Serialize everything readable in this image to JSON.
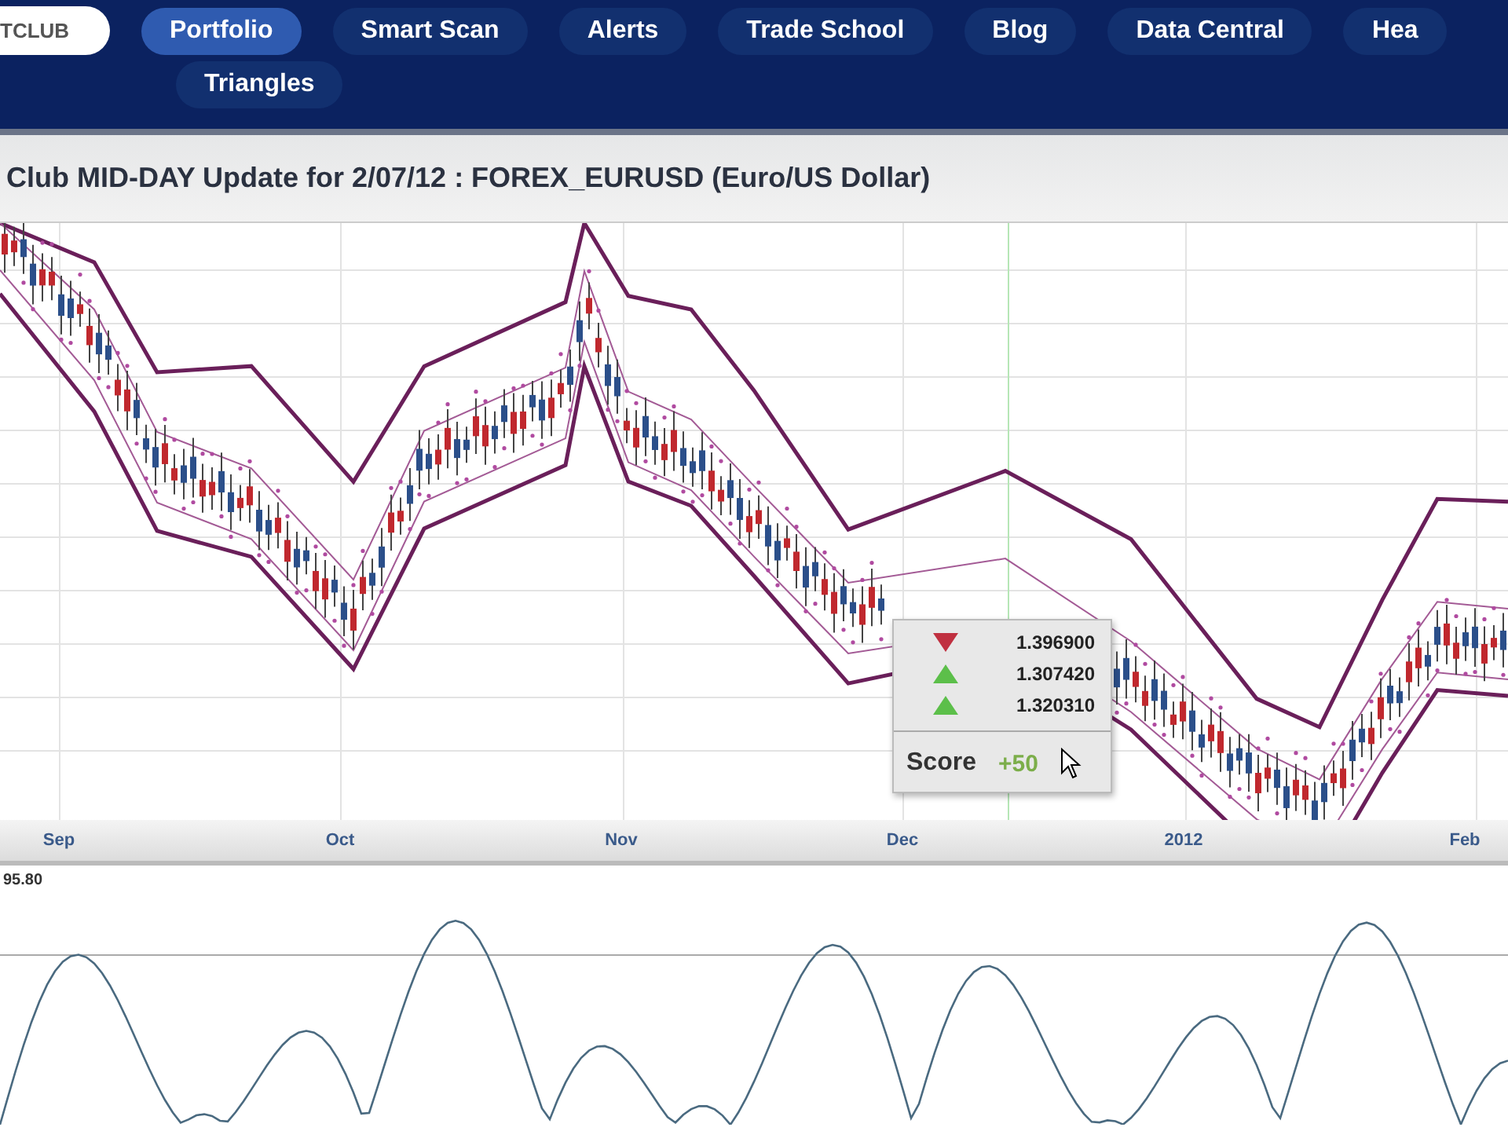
{
  "logo": {
    "text": "TCLUB"
  },
  "nav": {
    "items": [
      {
        "label": "Portfolio",
        "selected": true
      },
      {
        "label": "Smart Scan",
        "selected": false
      },
      {
        "label": "Alerts",
        "selected": false
      },
      {
        "label": "Trade School",
        "selected": false
      },
      {
        "label": "Blog",
        "selected": false
      },
      {
        "label": "Data Central",
        "selected": false
      },
      {
        "label": "Hea",
        "selected": false
      }
    ],
    "sub_items": [
      {
        "label": "Triangles",
        "selected": false
      }
    ]
  },
  "title": "Club MID-DAY Update for 2/07/12 : FOREX_EURUSD (Euro/US Dollar)",
  "popup": {
    "signals": [
      {
        "kind": "down",
        "value": "1.396900"
      },
      {
        "kind": "up",
        "value": "1.307420"
      },
      {
        "kind": "up",
        "value": "1.320310"
      }
    ],
    "score_label": "Score",
    "score_value": "+50"
  },
  "x_axis": [
    "Sep",
    "Oct",
    "Nov",
    "Dec",
    "2012",
    "Feb"
  ],
  "oscillator": {
    "label": "95.80"
  }
}
